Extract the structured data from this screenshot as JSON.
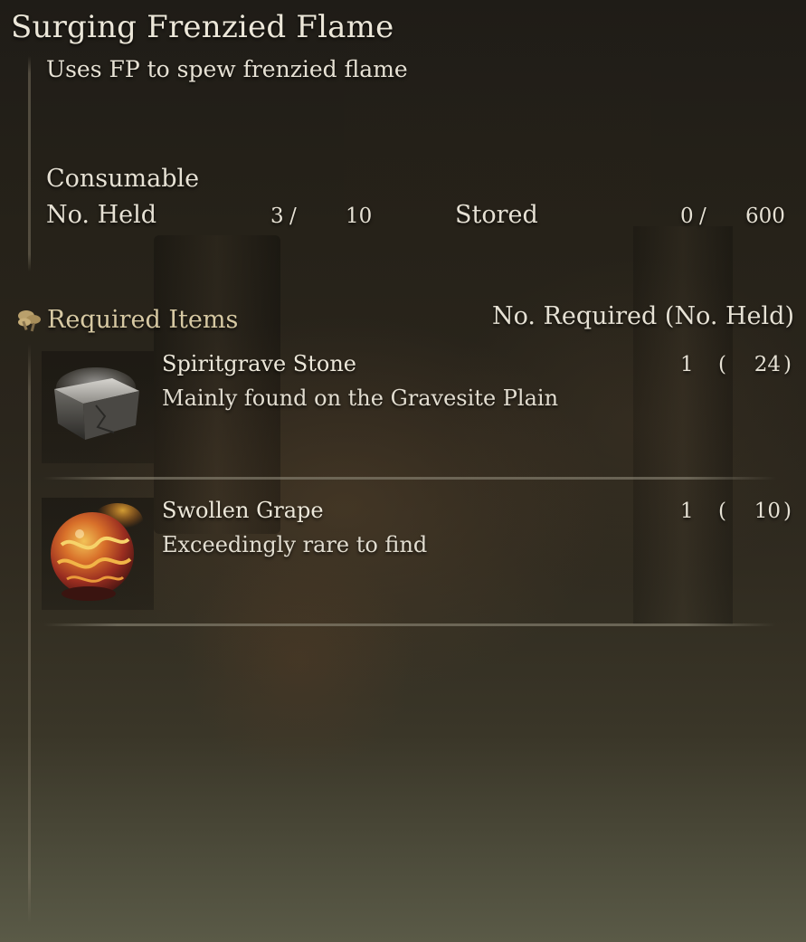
{
  "item": {
    "title": "Surging Frenzied Flame",
    "description": "Uses FP to spew frenzied flame",
    "category": "Consumable"
  },
  "stats": {
    "held_label": "No. Held",
    "held_count": "3",
    "slash": "/",
    "held_max": "10",
    "stored_label": "Stored",
    "stored_count": "0",
    "stored_max": "600"
  },
  "required": {
    "section_title": "Required Items",
    "column_header": "No. Required (No. Held)",
    "icon": "mushroom-cluster-icon",
    "open_paren": "(",
    "close_paren": ")",
    "items": [
      {
        "name": "Spiritgrave Stone",
        "flavor": "Mainly found on the Gravesite Plain",
        "required": "1",
        "held": "24",
        "icon": "spiritgrave-stone-icon"
      },
      {
        "name": "Swollen Grape",
        "flavor": "Exceedingly rare to find",
        "required": "1",
        "held": "10",
        "icon": "swollen-grape-icon"
      }
    ]
  },
  "colors": {
    "text": "#e6e1d4",
    "section_title": "#d7c9a3",
    "background_top": "#1f1c17",
    "background_bottom": "#5a5a47"
  }
}
